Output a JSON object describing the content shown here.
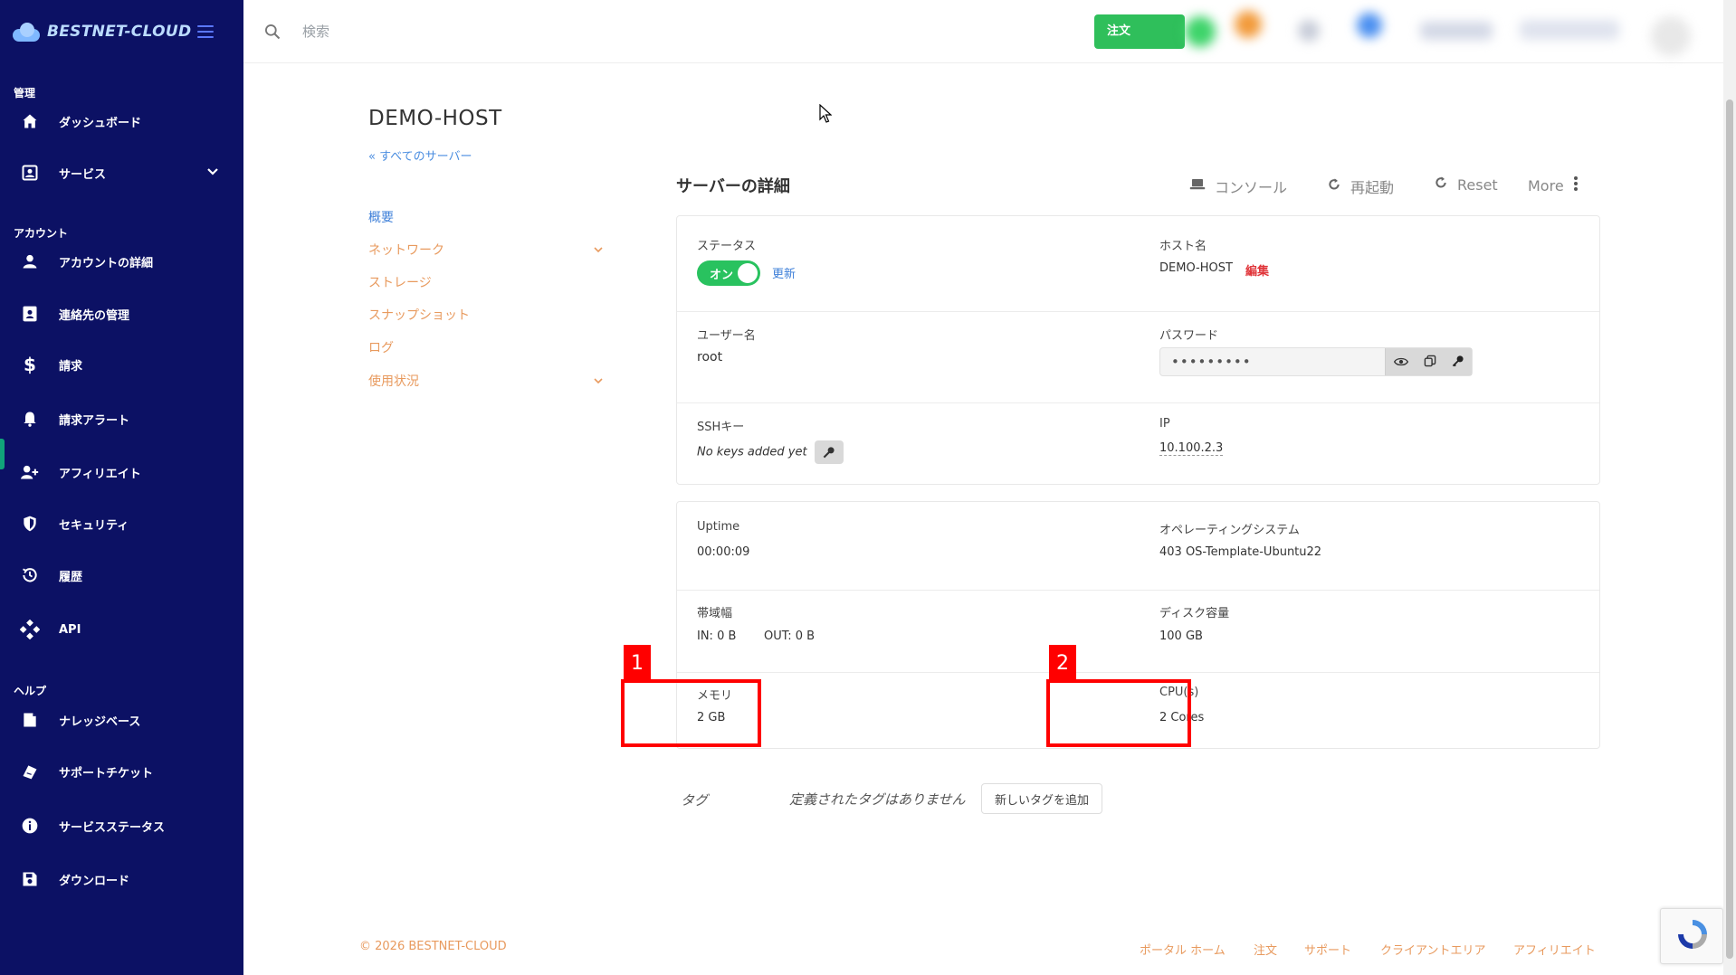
{
  "brand": {
    "name": "BESTNET-CLOUD"
  },
  "sidebar": {
    "sections": [
      {
        "label": "管理"
      },
      {
        "label": "アカウント"
      },
      {
        "label": "ヘルプ"
      }
    ],
    "items": [
      {
        "label": "ダッシュボード",
        "icon": "home-icon"
      },
      {
        "label": "サービス",
        "icon": "services-icon"
      },
      {
        "label": "アカウントの詳細",
        "icon": "user-icon"
      },
      {
        "label": "連絡先の管理",
        "icon": "contacts-icon"
      },
      {
        "label": "請求",
        "icon": "dollar-icon"
      },
      {
        "label": "請求アラート",
        "icon": "bell-icon"
      },
      {
        "label": "アフィリエイト",
        "icon": "user-plus-icon"
      },
      {
        "label": "セキュリティ",
        "icon": "shield-icon"
      },
      {
        "label": "履歴",
        "icon": "history-icon"
      },
      {
        "label": "API",
        "icon": "api-icon"
      },
      {
        "label": "ナレッジベース",
        "icon": "book-icon"
      },
      {
        "label": "サポートチケット",
        "icon": "ticket-icon"
      },
      {
        "label": "サービスステータス",
        "icon": "info-icon"
      },
      {
        "label": "ダウンロード",
        "icon": "save-icon"
      }
    ]
  },
  "topbar": {
    "search_placeholder": "検索",
    "order_label": "注文"
  },
  "page": {
    "title": "DEMO-HOST",
    "back_link": "« すべてのサーバー"
  },
  "subnav": [
    {
      "label": "概要",
      "active": true
    },
    {
      "label": "ネットワーク",
      "has_children": true
    },
    {
      "label": "ストレージ"
    },
    {
      "label": "スナップショット"
    },
    {
      "label": "ログ"
    },
    {
      "label": "使用状況",
      "has_children": true
    }
  ],
  "details": {
    "title": "サーバーの詳細",
    "actions": {
      "console": "コンソール",
      "reboot": "再起動",
      "reset": "Reset",
      "more": "More"
    },
    "status_label": "ステータス",
    "status_toggle": "オン",
    "status_refresh": "更新",
    "hostname_label": "ホスト名",
    "hostname_value": "DEMO-HOST",
    "hostname_edit": "編集",
    "username_label": "ユーザー名",
    "username_value": "root",
    "password_label": "パスワード",
    "password_value": "•••••••••",
    "ssh_label": "SSHキー",
    "ssh_value": "No keys added yet",
    "ip_label": "IP",
    "ip_value": "10.100.2.3"
  },
  "stats": {
    "uptime_label": "Uptime",
    "uptime_value": "00:00:09",
    "os_label": "オペレーティングシステム",
    "os_value": "403 OS-Template-Ubuntu22",
    "bandwidth_label": "帯域幅",
    "bandwidth_in": "IN: 0 B",
    "bandwidth_out": "OUT: 0 B",
    "disk_label": "ディスク容量",
    "disk_value": "100 GB",
    "memory_label": "メモリ",
    "memory_value": "2 GB",
    "cpu_label": "CPU(s)",
    "cpu_value": "2 Cores"
  },
  "annotations": [
    {
      "number": "1"
    },
    {
      "number": "2"
    }
  ],
  "tags": {
    "label": "タグ",
    "empty": "定義されたタグはありません",
    "add_button": "新しいタグを追加"
  },
  "footer": {
    "copyright": "© 2026 BESTNET-CLOUD",
    "links": [
      "ポータル ホーム",
      "注文",
      "サポート",
      "クライアントエリア",
      "アフィリエイト"
    ]
  },
  "colors": {
    "sidebar_bg": "#0c1164",
    "accent_orange": "#e89a5e",
    "accent_blue": "#3f80d9",
    "status_green": "#29c25f",
    "annotation_red": "#ff0000"
  }
}
